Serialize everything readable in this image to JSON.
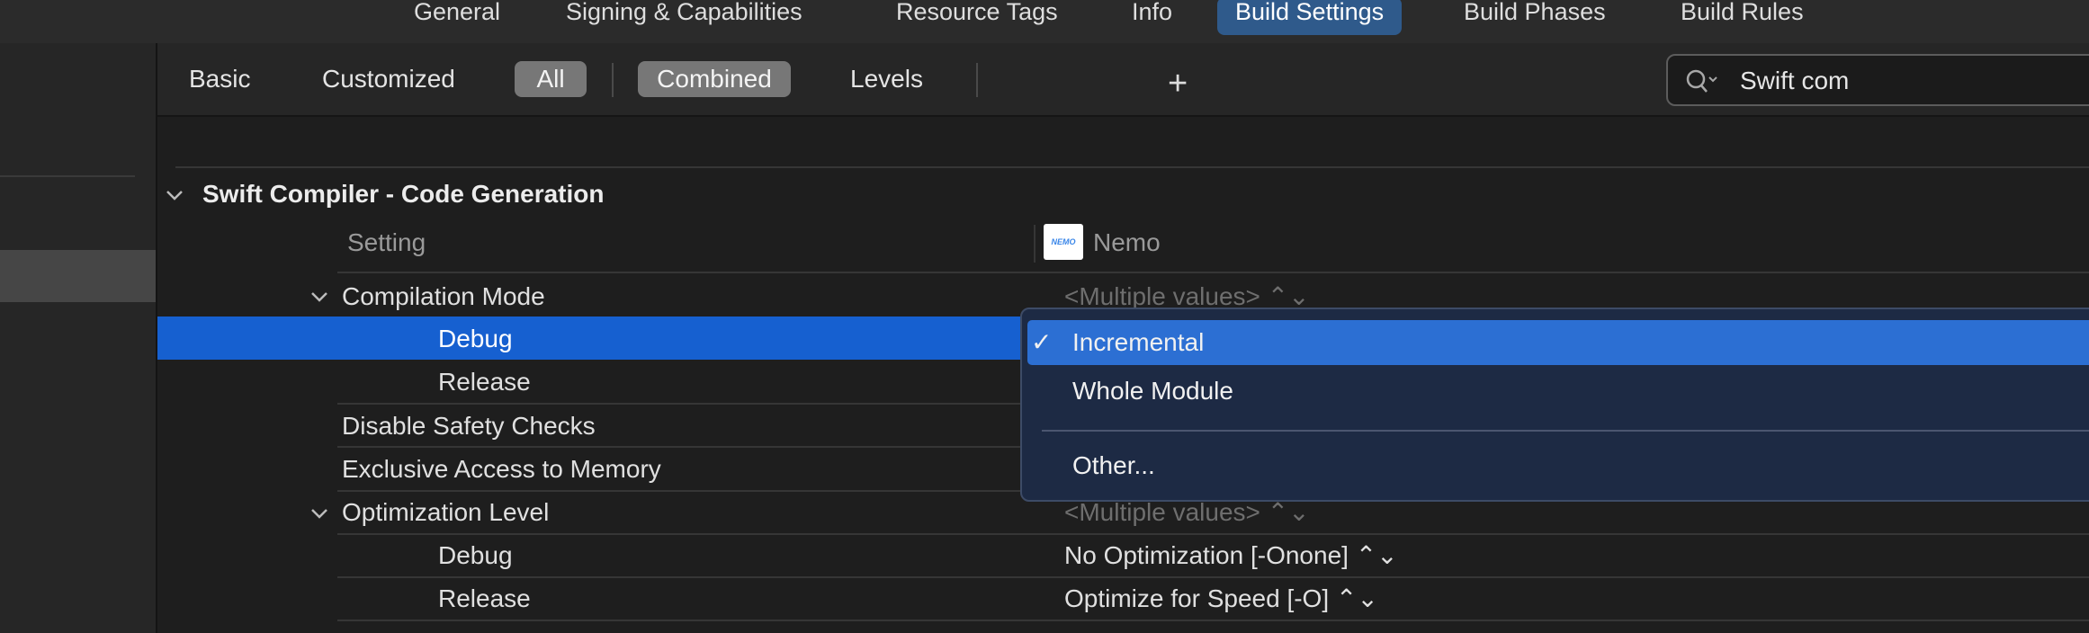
{
  "top_tabs": [
    "General",
    "Signing & Capabilities",
    "Resource Tags",
    "Info",
    "Build Settings",
    "Build Phases",
    "Build Rules"
  ],
  "filter": {
    "basic": "Basic",
    "customized": "Customized",
    "all": "All",
    "combined": "Combined",
    "levels": "Levels",
    "add": "+"
  },
  "search": {
    "value": "Swift com"
  },
  "section": {
    "title": "Swift Compiler - Code Generation"
  },
  "columns": {
    "setting": "Setting",
    "target": "Nemo",
    "target_logo_text": "NEMO"
  },
  "rows": {
    "compilation_mode": {
      "label": "Compilation Mode",
      "value": "<Multiple values> ⌃⌄"
    },
    "compilation_debug": {
      "label": "Debug"
    },
    "compilation_release": {
      "label": "Release"
    },
    "disable_safety": {
      "label": "Disable Safety Checks"
    },
    "exclusive_access": {
      "label": "Exclusive Access to Memory"
    },
    "optimization_level": {
      "label": "Optimization Level",
      "value": "<Multiple values> ⌃⌄"
    },
    "opt_debug": {
      "label": "Debug",
      "value": "No Optimization [-Onone] ⌃⌄"
    },
    "opt_release": {
      "label": "Release",
      "value": "Optimize for Speed [-O] ⌃⌄"
    }
  },
  "menu": {
    "check": "✓",
    "items": [
      "Incremental",
      "Whole Module",
      "Other..."
    ]
  },
  "colors": {
    "selection": "#1660d0",
    "menu_highlight": "#2c6fd3",
    "active_tab": "#2f5a8b"
  }
}
